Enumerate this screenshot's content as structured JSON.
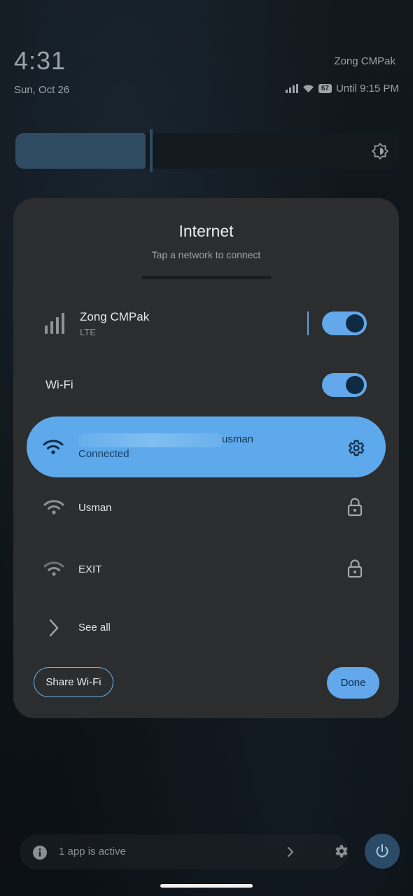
{
  "status_bar": {
    "time": "4:31",
    "date": "Sun, Oct 26",
    "carrier": "Zong CMPak",
    "battery_level": "67",
    "battery_text": "Until 9:15 PM"
  },
  "brightness": {
    "level": 0.34
  },
  "dialog": {
    "title": "Internet",
    "subtitle": "Tap a network to connect",
    "mobile": {
      "name": "Zong CMPak",
      "type": "LTE",
      "enabled": true
    },
    "wifi": {
      "label": "Wi-Fi",
      "enabled": true
    },
    "connected": {
      "ssid": "usman",
      "status": "Connected"
    },
    "networks": [
      {
        "name": "Usman",
        "secured": true
      },
      {
        "name": "EXIT",
        "secured": true
      }
    ],
    "see_all": "See all",
    "share_button": "Share Wi-Fi",
    "done_button": "Done"
  },
  "footer": {
    "active_apps": "1 app is active"
  },
  "colors": {
    "accent": "#62a8ea",
    "dialog_bg": "#2b2d2f",
    "connected_card": "#5ea9ec"
  }
}
